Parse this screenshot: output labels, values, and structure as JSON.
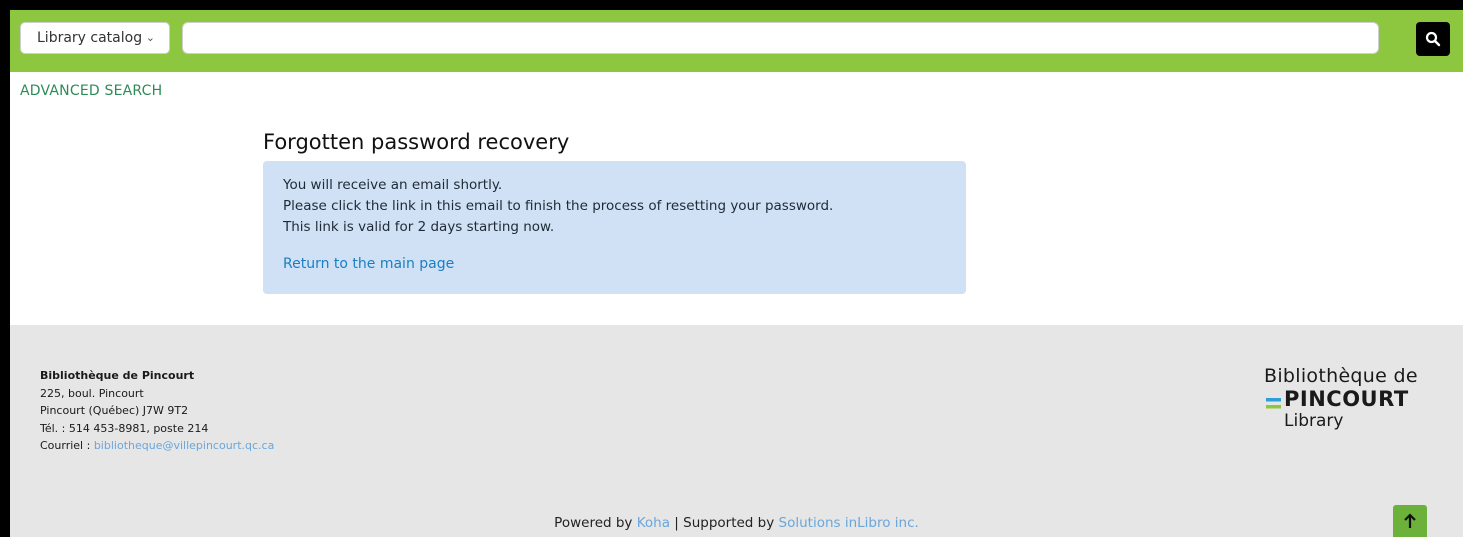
{
  "search": {
    "catalog_label": "Library catalog",
    "query_value": "",
    "query_placeholder": ""
  },
  "nav": {
    "advanced_search": "ADVANCED SEARCH"
  },
  "main": {
    "title": "Forgotten password recovery",
    "alert": {
      "line1": "You will receive an email shortly.",
      "line2": "Please click the link in this email to finish the process of resetting your password.",
      "line3": "This link is valid for 2 days starting now.",
      "return_link": "Return to the main page"
    }
  },
  "footer": {
    "library_name": "Bibliothèque de Pincourt",
    "address_line1": "225, boul. Pincourt",
    "address_line2": "Pincourt (Québec) J7W 9T2",
    "phone": "Tél. : 514 453-8981, poste 214",
    "email_label": "Courriel : ",
    "email": "bibliotheque@villepincourt.qc.ca",
    "logo": {
      "line1": "Bibliothèque de",
      "line2": "PINCOURT",
      "line3": "Library"
    },
    "powered_by_label": "Powered by ",
    "koha": "Koha",
    "separator": " | Supported by ",
    "inlibro": "Solutions inLibro inc."
  },
  "icons": {
    "search": "search-icon",
    "chevron": "chevron-down-icon",
    "back_to_top": "arrow-up-icon"
  },
  "colors": {
    "header_green": "#8dc63f",
    "alert_blue": "#d0e1f5",
    "link_blue": "#1a7fc1",
    "footer_gray": "#e6e6e6"
  }
}
